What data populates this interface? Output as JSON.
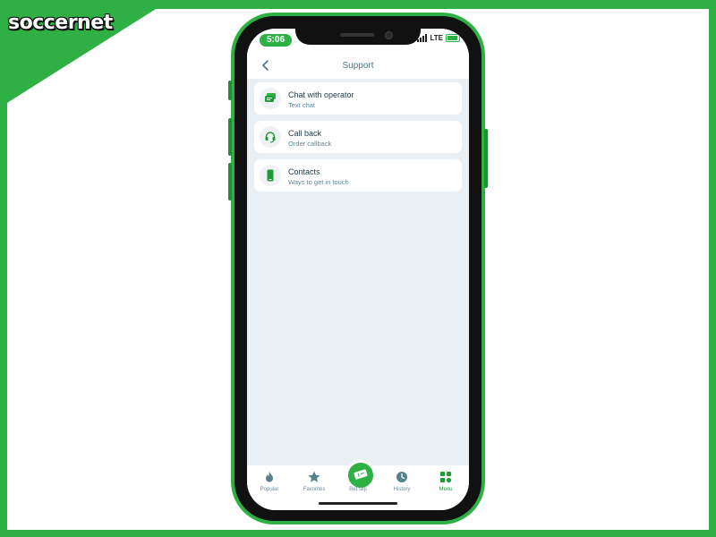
{
  "brand": {
    "logo_text": "soccernet",
    "accent_color": "#2fb045"
  },
  "status_bar": {
    "time": "5:06",
    "network": "LTE"
  },
  "header": {
    "title": "Support",
    "back_icon": "chevron-left-icon"
  },
  "support_items": [
    {
      "title": "Chat with operator",
      "subtitle": "Text chat",
      "icon": "chat-icon"
    },
    {
      "title": "Call back",
      "subtitle": "Order callback",
      "icon": "headset-icon"
    },
    {
      "title": "Contacts",
      "subtitle": "Ways to get in touch",
      "icon": "phone-icon"
    }
  ],
  "tab_bar": {
    "tabs": [
      {
        "label": "Popular",
        "icon": "flame-icon"
      },
      {
        "label": "Favorites",
        "icon": "star-icon"
      },
      {
        "label": "Bet slip",
        "icon": "ticket-icon"
      },
      {
        "label": "History",
        "icon": "clock-icon"
      },
      {
        "label": "Menu",
        "icon": "grid-icon"
      }
    ],
    "active": "Menu"
  }
}
